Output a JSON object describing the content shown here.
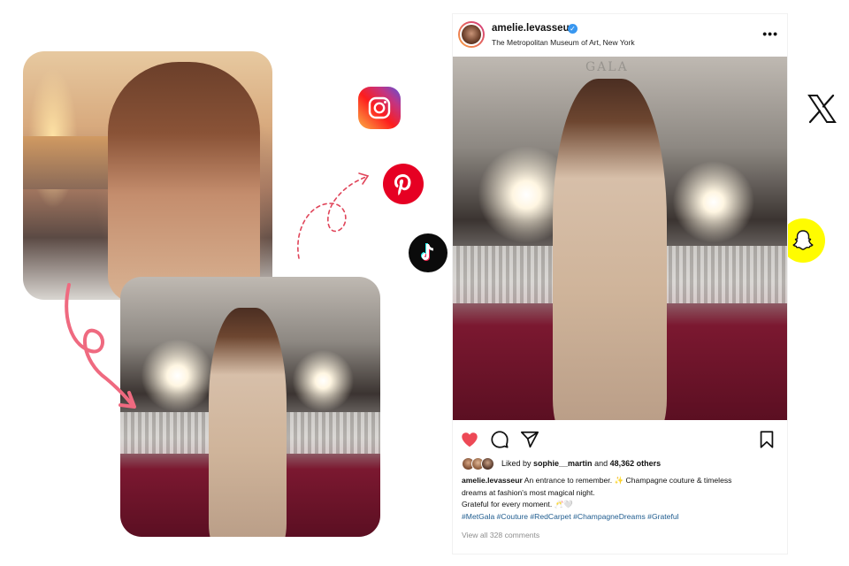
{
  "post": {
    "username": "amelie.levasseur",
    "location": "The Metropolitan Museum of Art, New York",
    "more_label": "•••",
    "image_sign_text": "GALA",
    "liked_prefix": "Liked by ",
    "liked_user": "sophie__martin",
    "liked_middle": " and ",
    "liked_count": "48,362 others",
    "caption_user": "amelie.levasseur",
    "caption_line1": " An entrance to remember. ✨ Champagne couture & timeless",
    "caption_line2": "dreams at fashion's most magical night.",
    "caption_line3": "Grateful for every moment. 🥂🤍",
    "hashtags": "#MetGala #Couture #RedCarpet #ChampagneDreams #Grateful",
    "view_comments": "View all 328 comments"
  },
  "icons": {
    "verified": "verified-badge-icon",
    "heart": "heart-icon",
    "comment": "comment-icon",
    "share": "share-icon",
    "bookmark": "bookmark-icon",
    "instagram": "instagram-icon",
    "pinterest": "pinterest-icon",
    "tiktok": "tiktok-icon",
    "x": "x-icon",
    "snapchat": "snapchat-icon"
  },
  "colors": {
    "like_red": "#ed4956",
    "pinterest": "#e60023",
    "snapchat": "#fffc00",
    "arrow_pink": "#ef6a80",
    "hashtag_blue": "#1f5c8f"
  }
}
